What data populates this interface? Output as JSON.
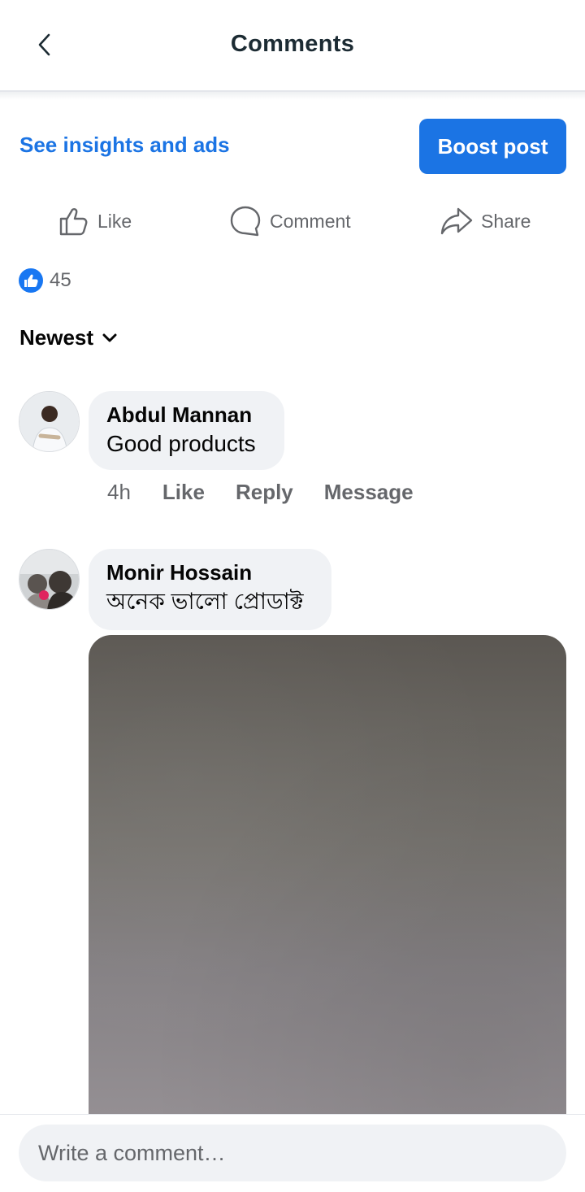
{
  "header": {
    "title": "Comments",
    "back_icon": "chevron-left-icon"
  },
  "post_actions": {
    "insights_label": "See insights and ads",
    "boost_label": "Boost post",
    "like_label": "Like",
    "comment_label": "Comment",
    "share_label": "Share"
  },
  "reactions": {
    "count": "45",
    "icon": "like-reaction-icon"
  },
  "sort": {
    "label": "Newest",
    "icon": "chevron-down-icon"
  },
  "comments": [
    {
      "author": "Abdul Mannan",
      "text": "Good products",
      "time": "4h",
      "like_label": "Like",
      "reply_label": "Reply",
      "message_label": "Message"
    },
    {
      "author": "Monir Hossain",
      "text": "অনেক ভালো প্রোডাক্ট",
      "has_media": true
    }
  ],
  "composer": {
    "placeholder": "Write a comment…"
  },
  "colors": {
    "accent": "#1b74e4",
    "bubble": "#f0f2f5",
    "secondary_text": "#65676b"
  }
}
